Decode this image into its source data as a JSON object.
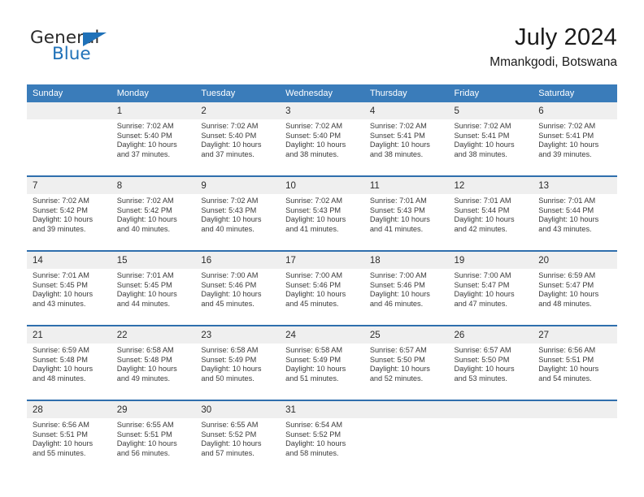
{
  "brand": {
    "name_part1": "General",
    "name_part2": "Blue",
    "accent_color": "#1f71b8",
    "triangle_icon": "triangle-icon"
  },
  "header": {
    "title": "July 2024",
    "subtitle": "Mmankgodi, Botswana"
  },
  "theme": {
    "header_blue": "#3a7cba",
    "separator_blue": "#2f6fad",
    "daynum_band": "#efefef"
  },
  "weekday_headers": [
    "Sunday",
    "Monday",
    "Tuesday",
    "Wednesday",
    "Thursday",
    "Friday",
    "Saturday"
  ],
  "weeks": [
    {
      "days": [
        {
          "num": "",
          "sunrise": "",
          "sunset": "",
          "daylight1": "",
          "daylight2": ""
        },
        {
          "num": "1",
          "sunrise": "Sunrise: 7:02 AM",
          "sunset": "Sunset: 5:40 PM",
          "daylight1": "Daylight: 10 hours",
          "daylight2": "and 37 minutes."
        },
        {
          "num": "2",
          "sunrise": "Sunrise: 7:02 AM",
          "sunset": "Sunset: 5:40 PM",
          "daylight1": "Daylight: 10 hours",
          "daylight2": "and 37 minutes."
        },
        {
          "num": "3",
          "sunrise": "Sunrise: 7:02 AM",
          "sunset": "Sunset: 5:40 PM",
          "daylight1": "Daylight: 10 hours",
          "daylight2": "and 38 minutes."
        },
        {
          "num": "4",
          "sunrise": "Sunrise: 7:02 AM",
          "sunset": "Sunset: 5:41 PM",
          "daylight1": "Daylight: 10 hours",
          "daylight2": "and 38 minutes."
        },
        {
          "num": "5",
          "sunrise": "Sunrise: 7:02 AM",
          "sunset": "Sunset: 5:41 PM",
          "daylight1": "Daylight: 10 hours",
          "daylight2": "and 38 minutes."
        },
        {
          "num": "6",
          "sunrise": "Sunrise: 7:02 AM",
          "sunset": "Sunset: 5:41 PM",
          "daylight1": "Daylight: 10 hours",
          "daylight2": "and 39 minutes."
        }
      ]
    },
    {
      "days": [
        {
          "num": "7",
          "sunrise": "Sunrise: 7:02 AM",
          "sunset": "Sunset: 5:42 PM",
          "daylight1": "Daylight: 10 hours",
          "daylight2": "and 39 minutes."
        },
        {
          "num": "8",
          "sunrise": "Sunrise: 7:02 AM",
          "sunset": "Sunset: 5:42 PM",
          "daylight1": "Daylight: 10 hours",
          "daylight2": "and 40 minutes."
        },
        {
          "num": "9",
          "sunrise": "Sunrise: 7:02 AM",
          "sunset": "Sunset: 5:43 PM",
          "daylight1": "Daylight: 10 hours",
          "daylight2": "and 40 minutes."
        },
        {
          "num": "10",
          "sunrise": "Sunrise: 7:02 AM",
          "sunset": "Sunset: 5:43 PM",
          "daylight1": "Daylight: 10 hours",
          "daylight2": "and 41 minutes."
        },
        {
          "num": "11",
          "sunrise": "Sunrise: 7:01 AM",
          "sunset": "Sunset: 5:43 PM",
          "daylight1": "Daylight: 10 hours",
          "daylight2": "and 41 minutes."
        },
        {
          "num": "12",
          "sunrise": "Sunrise: 7:01 AM",
          "sunset": "Sunset: 5:44 PM",
          "daylight1": "Daylight: 10 hours",
          "daylight2": "and 42 minutes."
        },
        {
          "num": "13",
          "sunrise": "Sunrise: 7:01 AM",
          "sunset": "Sunset: 5:44 PM",
          "daylight1": "Daylight: 10 hours",
          "daylight2": "and 43 minutes."
        }
      ]
    },
    {
      "days": [
        {
          "num": "14",
          "sunrise": "Sunrise: 7:01 AM",
          "sunset": "Sunset: 5:45 PM",
          "daylight1": "Daylight: 10 hours",
          "daylight2": "and 43 minutes."
        },
        {
          "num": "15",
          "sunrise": "Sunrise: 7:01 AM",
          "sunset": "Sunset: 5:45 PM",
          "daylight1": "Daylight: 10 hours",
          "daylight2": "and 44 minutes."
        },
        {
          "num": "16",
          "sunrise": "Sunrise: 7:00 AM",
          "sunset": "Sunset: 5:46 PM",
          "daylight1": "Daylight: 10 hours",
          "daylight2": "and 45 minutes."
        },
        {
          "num": "17",
          "sunrise": "Sunrise: 7:00 AM",
          "sunset": "Sunset: 5:46 PM",
          "daylight1": "Daylight: 10 hours",
          "daylight2": "and 45 minutes."
        },
        {
          "num": "18",
          "sunrise": "Sunrise: 7:00 AM",
          "sunset": "Sunset: 5:46 PM",
          "daylight1": "Daylight: 10 hours",
          "daylight2": "and 46 minutes."
        },
        {
          "num": "19",
          "sunrise": "Sunrise: 7:00 AM",
          "sunset": "Sunset: 5:47 PM",
          "daylight1": "Daylight: 10 hours",
          "daylight2": "and 47 minutes."
        },
        {
          "num": "20",
          "sunrise": "Sunrise: 6:59 AM",
          "sunset": "Sunset: 5:47 PM",
          "daylight1": "Daylight: 10 hours",
          "daylight2": "and 48 minutes."
        }
      ]
    },
    {
      "days": [
        {
          "num": "21",
          "sunrise": "Sunrise: 6:59 AM",
          "sunset": "Sunset: 5:48 PM",
          "daylight1": "Daylight: 10 hours",
          "daylight2": "and 48 minutes."
        },
        {
          "num": "22",
          "sunrise": "Sunrise: 6:58 AM",
          "sunset": "Sunset: 5:48 PM",
          "daylight1": "Daylight: 10 hours",
          "daylight2": "and 49 minutes."
        },
        {
          "num": "23",
          "sunrise": "Sunrise: 6:58 AM",
          "sunset": "Sunset: 5:49 PM",
          "daylight1": "Daylight: 10 hours",
          "daylight2": "and 50 minutes."
        },
        {
          "num": "24",
          "sunrise": "Sunrise: 6:58 AM",
          "sunset": "Sunset: 5:49 PM",
          "daylight1": "Daylight: 10 hours",
          "daylight2": "and 51 minutes."
        },
        {
          "num": "25",
          "sunrise": "Sunrise: 6:57 AM",
          "sunset": "Sunset: 5:50 PM",
          "daylight1": "Daylight: 10 hours",
          "daylight2": "and 52 minutes."
        },
        {
          "num": "26",
          "sunrise": "Sunrise: 6:57 AM",
          "sunset": "Sunset: 5:50 PM",
          "daylight1": "Daylight: 10 hours",
          "daylight2": "and 53 minutes."
        },
        {
          "num": "27",
          "sunrise": "Sunrise: 6:56 AM",
          "sunset": "Sunset: 5:51 PM",
          "daylight1": "Daylight: 10 hours",
          "daylight2": "and 54 minutes."
        }
      ]
    },
    {
      "days": [
        {
          "num": "28",
          "sunrise": "Sunrise: 6:56 AM",
          "sunset": "Sunset: 5:51 PM",
          "daylight1": "Daylight: 10 hours",
          "daylight2": "and 55 minutes."
        },
        {
          "num": "29",
          "sunrise": "Sunrise: 6:55 AM",
          "sunset": "Sunset: 5:51 PM",
          "daylight1": "Daylight: 10 hours",
          "daylight2": "and 56 minutes."
        },
        {
          "num": "30",
          "sunrise": "Sunrise: 6:55 AM",
          "sunset": "Sunset: 5:52 PM",
          "daylight1": "Daylight: 10 hours",
          "daylight2": "and 57 minutes."
        },
        {
          "num": "31",
          "sunrise": "Sunrise: 6:54 AM",
          "sunset": "Sunset: 5:52 PM",
          "daylight1": "Daylight: 10 hours",
          "daylight2": "and 58 minutes."
        },
        {
          "num": "",
          "sunrise": "",
          "sunset": "",
          "daylight1": "",
          "daylight2": ""
        },
        {
          "num": "",
          "sunrise": "",
          "sunset": "",
          "daylight1": "",
          "daylight2": ""
        },
        {
          "num": "",
          "sunrise": "",
          "sunset": "",
          "daylight1": "",
          "daylight2": ""
        }
      ]
    }
  ]
}
